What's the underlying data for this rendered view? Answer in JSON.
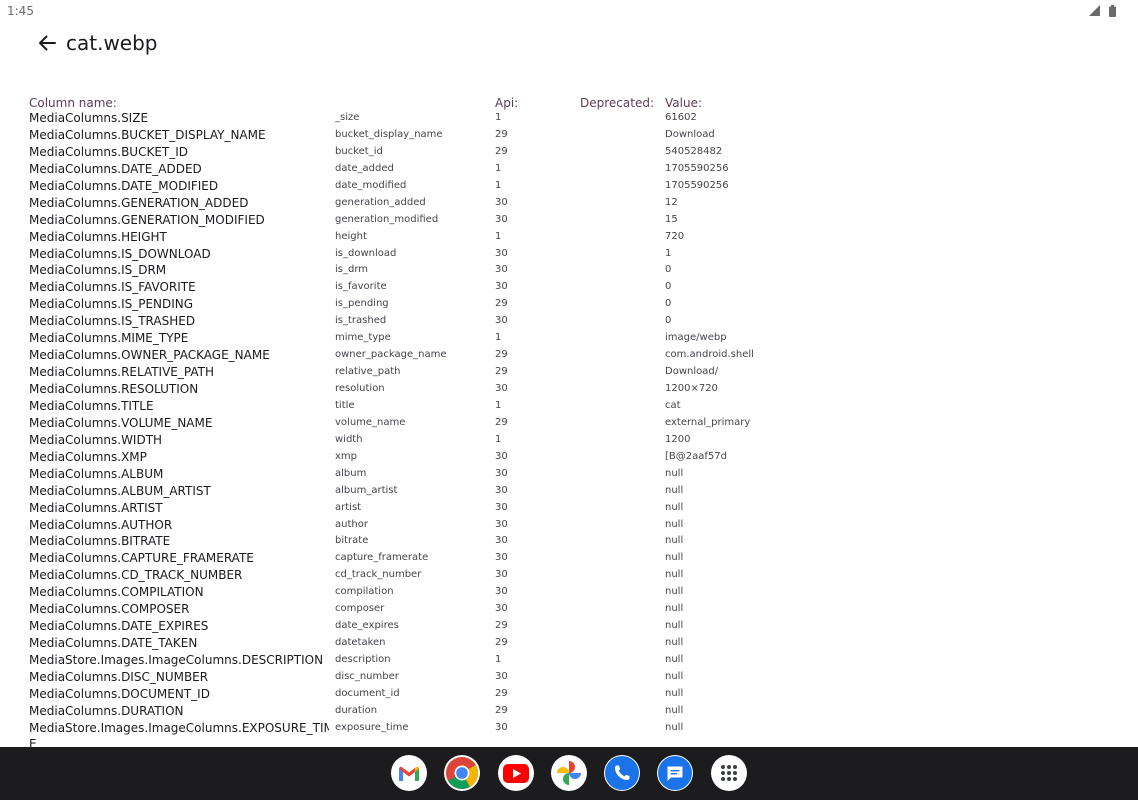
{
  "status": {
    "time": "1:45"
  },
  "appbar": {
    "title": "cat.webp"
  },
  "table": {
    "headers": {
      "column": "Column name:",
      "api": "Api:",
      "deprecated": "Deprecated:",
      "value": "Value:"
    },
    "rows": [
      [
        "MediaColumns.SIZE",
        "_size",
        "1",
        "61602"
      ],
      [
        "MediaColumns.BUCKET_DISPLAY_NAME",
        "bucket_display_name",
        "29",
        "Download"
      ],
      [
        "MediaColumns.BUCKET_ID",
        "bucket_id",
        "29",
        "540528482"
      ],
      [
        "MediaColumns.DATE_ADDED",
        "date_added",
        "1",
        "1705590256"
      ],
      [
        "MediaColumns.DATE_MODIFIED",
        "date_modified",
        "1",
        "1705590256"
      ],
      [
        "MediaColumns.GENERATION_ADDED",
        "generation_added",
        "30",
        "12"
      ],
      [
        "MediaColumns.GENERATION_MODIFIED",
        "generation_modified",
        "30",
        "15"
      ],
      [
        "MediaColumns.HEIGHT",
        "height",
        "1",
        "720"
      ],
      [
        "MediaColumns.IS_DOWNLOAD",
        "is_download",
        "30",
        "1"
      ],
      [
        "MediaColumns.IS_DRM",
        "is_drm",
        "30",
        "0"
      ],
      [
        "MediaColumns.IS_FAVORITE",
        "is_favorite",
        "30",
        "0"
      ],
      [
        "MediaColumns.IS_PENDING",
        "is_pending",
        "29",
        "0"
      ],
      [
        "MediaColumns.IS_TRASHED",
        "is_trashed",
        "30",
        "0"
      ],
      [
        "MediaColumns.MIME_TYPE",
        "mime_type",
        "1",
        "image/webp"
      ],
      [
        "MediaColumns.OWNER_PACKAGE_NAME",
        "owner_package_name",
        "29",
        "com.android.shell"
      ],
      [
        "MediaColumns.RELATIVE_PATH",
        "relative_path",
        "29",
        "Download/"
      ],
      [
        "MediaColumns.RESOLUTION",
        "resolution",
        "30",
        "1200×720"
      ],
      [
        "MediaColumns.TITLE",
        "title",
        "1",
        "cat"
      ],
      [
        "MediaColumns.VOLUME_NAME",
        "volume_name",
        "29",
        "external_primary"
      ],
      [
        "MediaColumns.WIDTH",
        "width",
        "1",
        "1200"
      ],
      [
        "MediaColumns.XMP",
        "xmp",
        "30",
        "[B@2aaf57d"
      ],
      [
        "MediaColumns.ALBUM",
        "album",
        "30",
        "null"
      ],
      [
        "MediaColumns.ALBUM_ARTIST",
        "album_artist",
        "30",
        "null"
      ],
      [
        "MediaColumns.ARTIST",
        "artist",
        "30",
        "null"
      ],
      [
        "MediaColumns.AUTHOR",
        "author",
        "30",
        "null"
      ],
      [
        "MediaColumns.BITRATE",
        "bitrate",
        "30",
        "null"
      ],
      [
        "MediaColumns.CAPTURE_FRAMERATE",
        "capture_framerate",
        "30",
        "null"
      ],
      [
        "MediaColumns.CD_TRACK_NUMBER",
        "cd_track_number",
        "30",
        "null"
      ],
      [
        "MediaColumns.COMPILATION",
        "compilation",
        "30",
        "null"
      ],
      [
        "MediaColumns.COMPOSER",
        "composer",
        "30",
        "null"
      ],
      [
        "MediaColumns.DATE_EXPIRES",
        "date_expires",
        "29",
        "null"
      ],
      [
        "MediaColumns.DATE_TAKEN",
        "datetaken",
        "29",
        "null"
      ],
      [
        "MediaStore.Images.ImageColumns.DESCRIPTION",
        "description",
        "1",
        "null"
      ],
      [
        "MediaColumns.DISC_NUMBER",
        "disc_number",
        "30",
        "null"
      ],
      [
        "MediaColumns.DOCUMENT_ID",
        "document_id",
        "29",
        "null"
      ],
      [
        "MediaColumns.DURATION",
        "duration",
        "29",
        "null"
      ],
      [
        "MediaStore.Images.ImageColumns.EXPOSURE_TIM",
        "exposure_time",
        "30",
        "null"
      ]
    ],
    "wrap_tail": "E"
  },
  "taskbar": {
    "apps": [
      {
        "icon": "gmail-icon"
      },
      {
        "icon": "chrome-icon"
      },
      {
        "icon": "youtube-icon"
      },
      {
        "icon": "photos-icon"
      },
      {
        "icon": "phone-icon"
      },
      {
        "icon": "messages-icon"
      },
      {
        "icon": "app-drawer-icon"
      }
    ]
  },
  "colors": {
    "header_text": "#5a3d55",
    "taskbar": "#1c1c1e",
    "primary_text": "#1b1b1f"
  }
}
